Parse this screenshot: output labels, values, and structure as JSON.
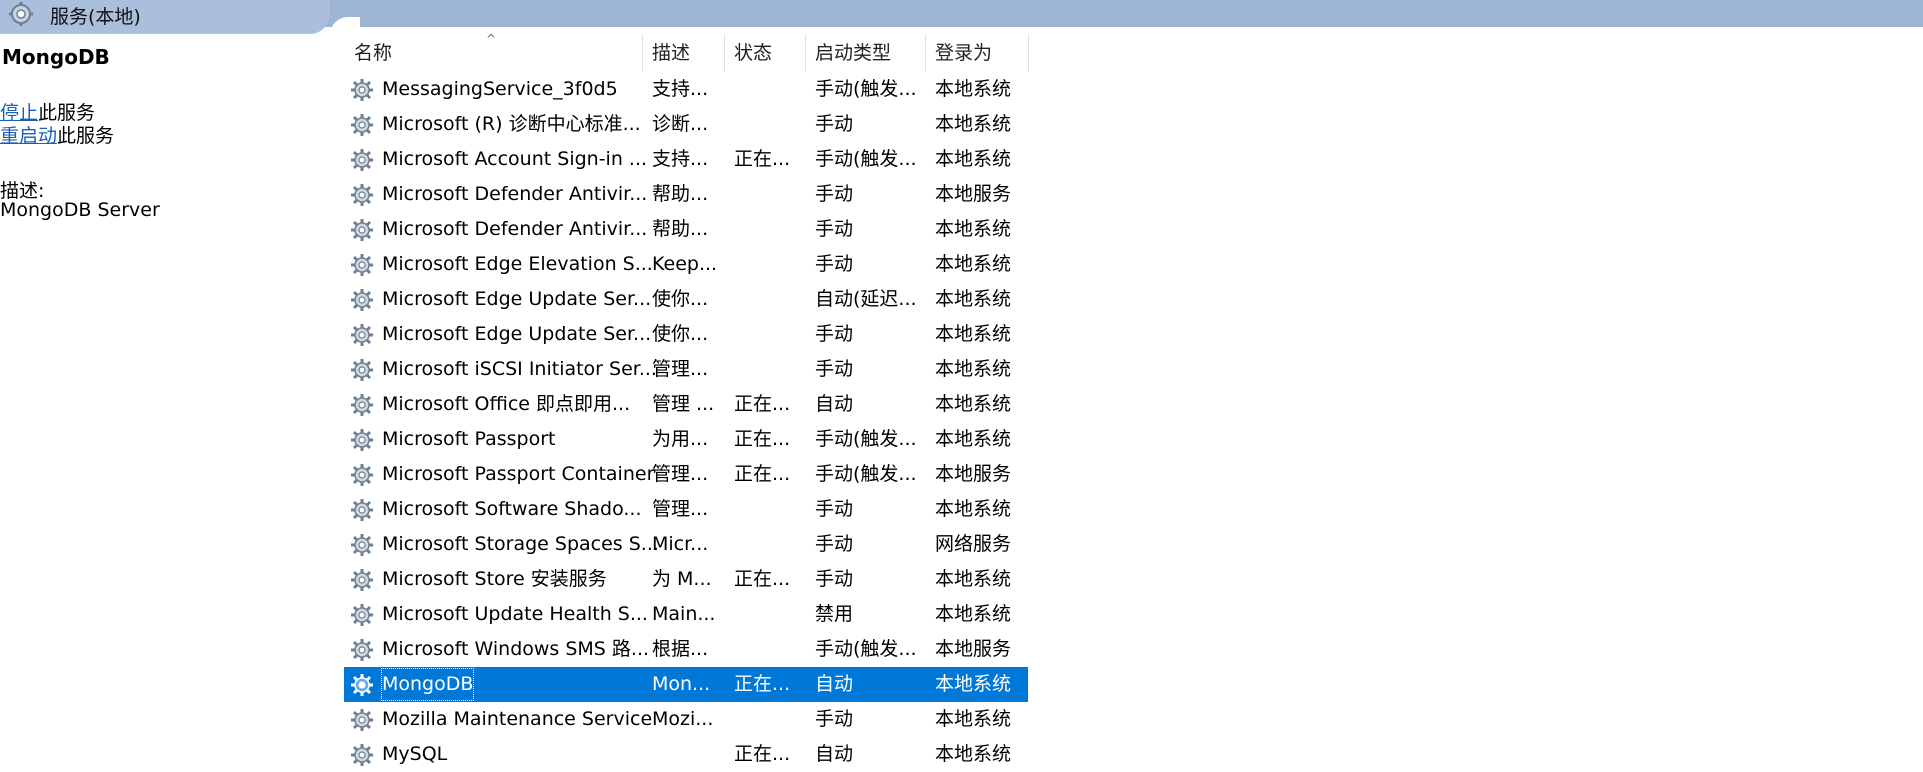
{
  "window": {
    "title": "服务(本地)"
  },
  "left_pane": {
    "service_name": "MongoDB",
    "actions": [
      {
        "link": "停止",
        "suffix": "此服务"
      },
      {
        "link": "重启动",
        "suffix": "此服务"
      }
    ],
    "description_label": "描述:",
    "description": "MongoDB Server"
  },
  "table": {
    "headers": [
      "名称",
      "描述",
      "状态",
      "启动类型",
      "登录为"
    ],
    "rows": [
      {
        "name": "MessagingService_3f0d5",
        "desc": "支持...",
        "status": "",
        "startup": "手动(触发...",
        "logon": "本地系统"
      },
      {
        "name": "Microsoft (R) 诊断中心标准...",
        "desc": "诊断...",
        "status": "",
        "startup": "手动",
        "logon": "本地系统"
      },
      {
        "name": "Microsoft Account Sign-in ...",
        "desc": "支持...",
        "status": "正在...",
        "startup": "手动(触发...",
        "logon": "本地系统"
      },
      {
        "name": "Microsoft Defender Antivir...",
        "desc": "帮助...",
        "status": "",
        "startup": "手动",
        "logon": "本地服务"
      },
      {
        "name": "Microsoft Defender Antivir...",
        "desc": "帮助...",
        "status": "",
        "startup": "手动",
        "logon": "本地系统"
      },
      {
        "name": "Microsoft Edge Elevation S...",
        "desc": "Keep...",
        "status": "",
        "startup": "手动",
        "logon": "本地系统"
      },
      {
        "name": "Microsoft Edge Update Ser...",
        "desc": "使你...",
        "status": "",
        "startup": "自动(延迟...",
        "logon": "本地系统"
      },
      {
        "name": "Microsoft Edge Update Ser...",
        "desc": "使你...",
        "status": "",
        "startup": "手动",
        "logon": "本地系统"
      },
      {
        "name": "Microsoft iSCSI Initiator Ser...",
        "desc": "管理...",
        "status": "",
        "startup": "手动",
        "logon": "本地系统"
      },
      {
        "name": "Microsoft Office 即点即用...",
        "desc": "管理 ...",
        "status": "正在...",
        "startup": "自动",
        "logon": "本地系统"
      },
      {
        "name": "Microsoft Passport",
        "desc": "为用...",
        "status": "正在...",
        "startup": "手动(触发...",
        "logon": "本地系统"
      },
      {
        "name": "Microsoft Passport Container",
        "desc": "管理...",
        "status": "正在...",
        "startup": "手动(触发...",
        "logon": "本地服务"
      },
      {
        "name": "Microsoft Software Shado...",
        "desc": "管理...",
        "status": "",
        "startup": "手动",
        "logon": "本地系统"
      },
      {
        "name": "Microsoft Storage Spaces S...",
        "desc": "Micr...",
        "status": "",
        "startup": "手动",
        "logon": "网络服务"
      },
      {
        "name": "Microsoft Store 安装服务",
        "desc": "为 M...",
        "status": "正在...",
        "startup": "手动",
        "logon": "本地系统"
      },
      {
        "name": "Microsoft Update Health S...",
        "desc": "Main...",
        "status": "",
        "startup": "禁用",
        "logon": "本地系统"
      },
      {
        "name": "Microsoft Windows SMS 路...",
        "desc": "根据...",
        "status": "",
        "startup": "手动(触发...",
        "logon": "本地服务"
      },
      {
        "name": "MongoDB",
        "desc": "Mon...",
        "status": "正在...",
        "startup": "自动",
        "logon": "本地系统",
        "selected": true
      },
      {
        "name": "Mozilla Maintenance Service",
        "desc": "Mozi...",
        "status": "",
        "startup": "手动",
        "logon": "本地系统"
      },
      {
        "name": "MySQL",
        "desc": "",
        "status": "正在...",
        "startup": "自动",
        "logon": "本地系统"
      }
    ]
  },
  "colors": {
    "titlebar": "#9db4d2",
    "selection": "#0078d7",
    "link": "#1a5fb4"
  },
  "icons": {
    "window": "services-gear-icon",
    "row": "service-gear-icon"
  }
}
